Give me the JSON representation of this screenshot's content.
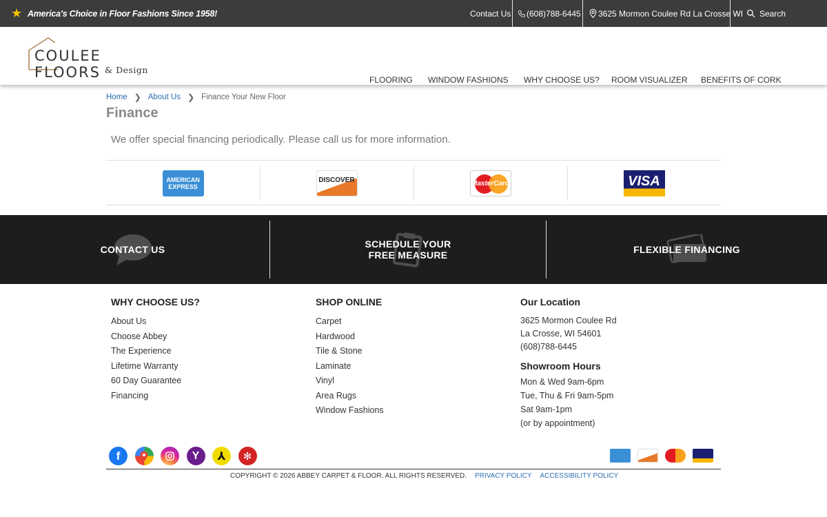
{
  "topbar": {
    "tagline": "America's Choice in Floor Fashions Since 1958!",
    "contact": "Contact Us",
    "phone": "(608)788-6445",
    "address": "3625 Mormon Coulee Rd La Crosse WI",
    "search": "Search"
  },
  "logo": {
    "name": "COULEE FLOORS",
    "sub": "& Design"
  },
  "nav": [
    "FLOORING",
    "WINDOW FASHIONS",
    "WHY CHOOSE US?",
    "ROOM VISUALIZER",
    "BENEFITS OF CORK"
  ],
  "breadcrumb": {
    "home": "Home",
    "about": "About Us",
    "current": "Finance Your New Floor"
  },
  "page": {
    "title": "Finance",
    "intro": "We offer special financing periodically. Please call us for more information."
  },
  "cards": {
    "amex": "AMERICAN EXPRESS",
    "discover": "DISCOVER",
    "mastercard": "MasterCard",
    "visa": "VISA"
  },
  "cta": {
    "contact": "CONTACT US",
    "schedule_1": "SCHEDULE YOUR",
    "schedule_2": "FREE MEASURE",
    "financing": "FLEXIBLE FINANCING"
  },
  "footer": {
    "why": {
      "title": "WHY CHOOSE US?",
      "links": [
        "About Us",
        "Choose Abbey",
        "The Experience",
        "Lifetime Warranty",
        "60 Day Guarantee",
        "Financing"
      ]
    },
    "shop": {
      "title": "SHOP ONLINE",
      "links": [
        "Carpet",
        "Hardwood",
        "Tile & Stone",
        "Laminate",
        "Vinyl",
        "Area Rugs",
        "Window Fashions"
      ]
    },
    "location": {
      "title": "Our Location",
      "street": "3625 Mormon Coulee Rd",
      "city": "La Crosse, WI 54601",
      "phone": "(608)788-6445",
      "hours_title": "Showroom Hours",
      "hours": [
        "Mon & Wed 9am-6pm",
        "Tue, Thu & Fri 9am-5pm",
        "Sat 9am-1pm",
        "(or by appointment)"
      ]
    },
    "copyright": "COPYRIGHT © 2026 ABBEY CARPET & FLOOR. ALL RIGHTS RESERVED.",
    "privacy": "PRIVACY POLICY",
    "accessibility": "ACCESSIBILITY POLICY"
  },
  "colors": {
    "topbar": "#3c3c3c",
    "cta_strip": "#1d1d1d",
    "link": "#2a6db0",
    "star": "#f2c200"
  }
}
